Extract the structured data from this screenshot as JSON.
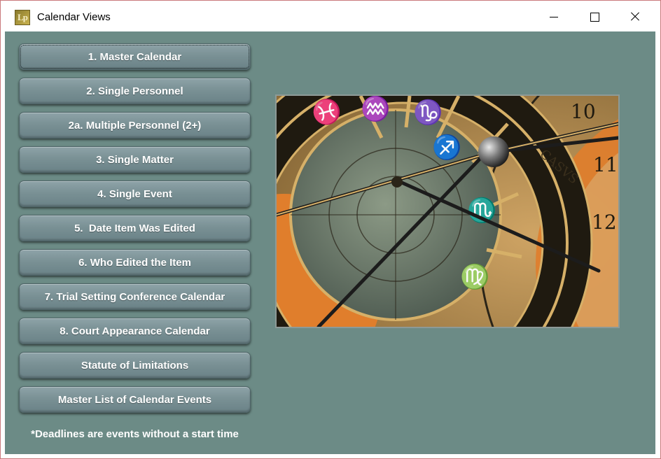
{
  "window": {
    "title": "Calendar Views",
    "app_icon_text": "Lp",
    "border_color": "#c9787c"
  },
  "menu": {
    "buttons": [
      {
        "label": "1. Master Calendar"
      },
      {
        "label": "2. Single Personnel"
      },
      {
        "label": "2a. Multiple Personnel (2+)"
      },
      {
        "label": "3. Single Matter"
      },
      {
        "label": "4. Single Event"
      },
      {
        "label": "5.  Date Item Was Edited"
      },
      {
        "label": "6. Who Edited the Item"
      },
      {
        "label": "7. Trial Setting Conference Calendar"
      },
      {
        "label": "8. Court Appearance Calendar"
      },
      {
        "label": "Statute of Limitations"
      },
      {
        "label": "Master List of Calendar Events"
      }
    ],
    "footnote": "*Deadlines are events without a start time"
  },
  "image": {
    "subject": "astronomical clock",
    "numerals": [
      "10",
      "11",
      "12"
    ],
    "engraving": "CASVS"
  },
  "colors": {
    "background": "#6c8b86",
    "button": "#7a9195",
    "button_text": "#ffffff"
  }
}
